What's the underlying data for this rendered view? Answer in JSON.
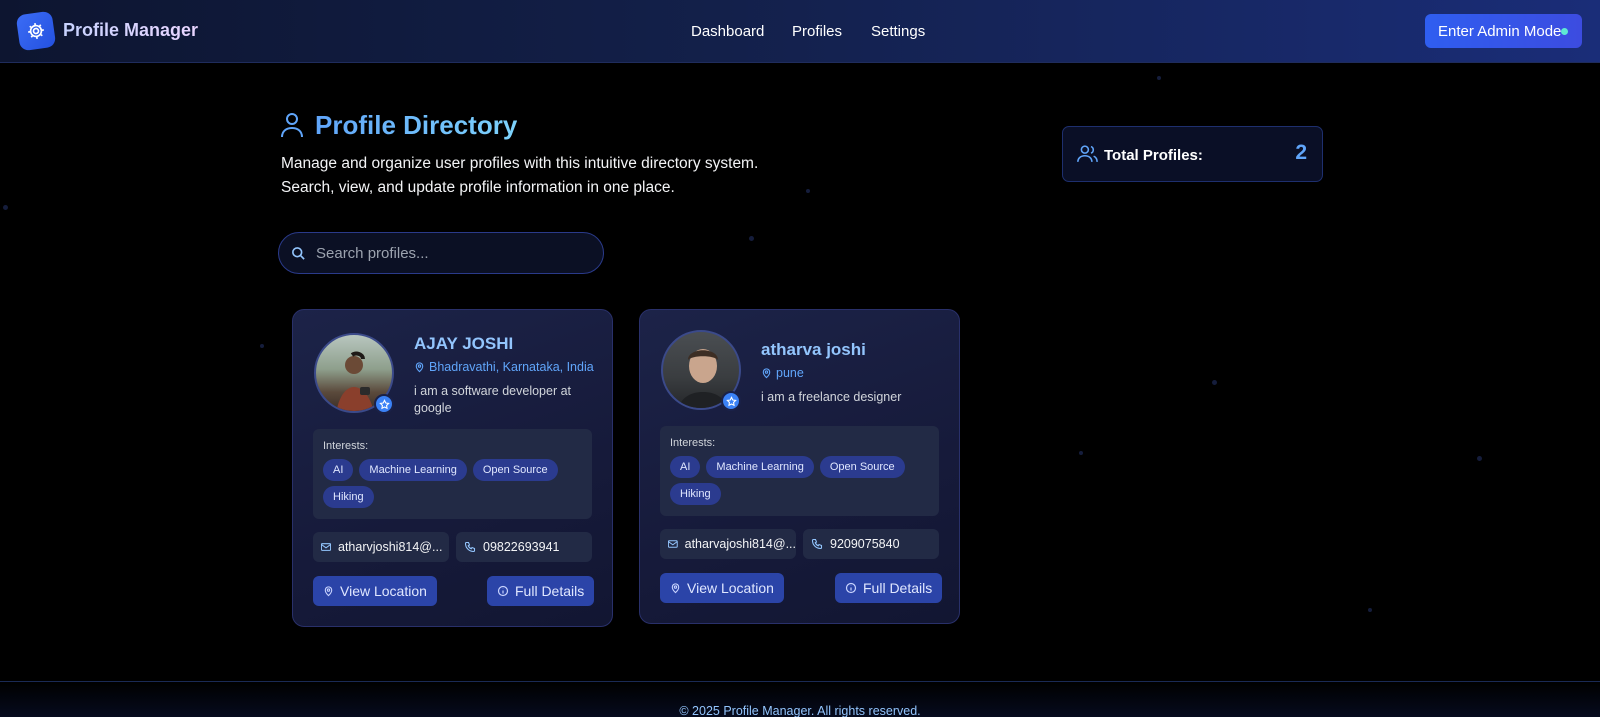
{
  "header": {
    "app_title": "Profile Manager",
    "nav": [
      "Dashboard",
      "Profiles",
      "Settings"
    ],
    "admin_button": "Enter Admin Mode"
  },
  "directory": {
    "title": "Profile Directory",
    "description_line1": "Manage and organize user profiles with this intuitive directory system.",
    "description_line2": "Search, view, and update profile information in one place."
  },
  "search": {
    "placeholder": "Search profiles..."
  },
  "stats": {
    "total_label": "Total Profiles:",
    "total_count": "2"
  },
  "profiles": [
    {
      "name": "AJAY JOSHI",
      "location": "Bhadravathi, Karnataka, India",
      "bio": "i am a software developer at google",
      "interests_label": "Interests:",
      "interests": [
        "AI",
        "Machine Learning",
        "Open Source",
        "Hiking"
      ],
      "email": "atharvjoshi814@...",
      "phone": "09822693941",
      "view_location": "View Location",
      "full_details": "Full Details"
    },
    {
      "name": "atharva joshi",
      "location": "pune",
      "bio": "i am a freelance designer",
      "interests_label": "Interests:",
      "interests": [
        "AI",
        "Machine Learning",
        "Open Source",
        "Hiking"
      ],
      "email": "atharvajoshi814@...",
      "phone": "9209075840",
      "view_location": "View Location",
      "full_details": "Full Details"
    }
  ],
  "footer": {
    "text": "© 2025 Profile Manager. All rights reserved."
  },
  "colors": {
    "accent": "#3b82f6",
    "tag_bg": "#2b3b8f",
    "card_bg": "#1c2348"
  }
}
